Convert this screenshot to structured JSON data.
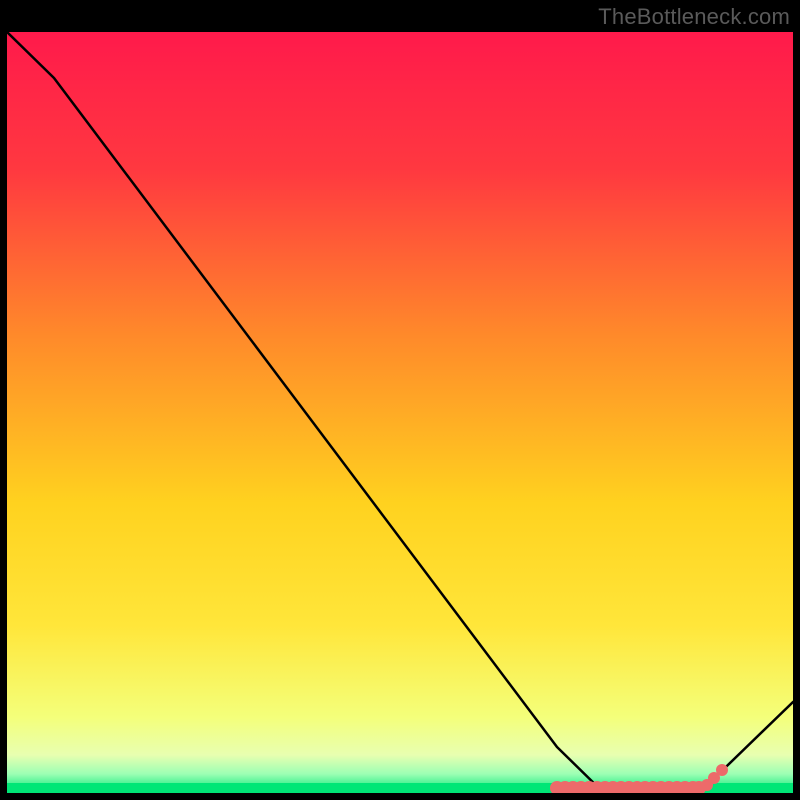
{
  "attribution": "TheBottleneck.com",
  "colors": {
    "top": "#ff1a4b",
    "mid_orange": "#ff8a2a",
    "yellow": "#ffe63a",
    "pale_yellow": "#f7ff9e",
    "strip": "#00e676",
    "curve": "#000000",
    "marker_fill": "#ed6a6a",
    "marker_stroke": "#b94848"
  },
  "chart_data": {
    "type": "line",
    "title": "",
    "xlabel": "",
    "ylabel": "",
    "xlim": [
      0,
      100
    ],
    "ylim": [
      0,
      100
    ],
    "series": [
      {
        "name": "bottleneck-curve",
        "x": [
          0,
          6,
          70,
          76,
          88,
          100
        ],
        "y": [
          100,
          94,
          6,
          0,
          0,
          12
        ]
      }
    ],
    "markers": {
      "name": "highlighted-range",
      "x_start": 70,
      "x_end": 91,
      "y": 0,
      "extra_points": [
        {
          "x": 89,
          "y": 1
        },
        {
          "x": 90,
          "y": 2
        },
        {
          "x": 91,
          "y": 3
        }
      ]
    },
    "green_band_y": [
      0,
      3
    ],
    "gradient_stops": [
      {
        "pos": 0.0,
        "color": "#ff1a4b"
      },
      {
        "pos": 0.18,
        "color": "#ff3840"
      },
      {
        "pos": 0.4,
        "color": "#ff8a2a"
      },
      {
        "pos": 0.62,
        "color": "#ffd21f"
      },
      {
        "pos": 0.78,
        "color": "#ffe63a"
      },
      {
        "pos": 0.9,
        "color": "#f4ff7a"
      },
      {
        "pos": 0.95,
        "color": "#e8ffb0"
      },
      {
        "pos": 0.975,
        "color": "#9cffb4"
      },
      {
        "pos": 1.0,
        "color": "#00e676"
      }
    ]
  }
}
